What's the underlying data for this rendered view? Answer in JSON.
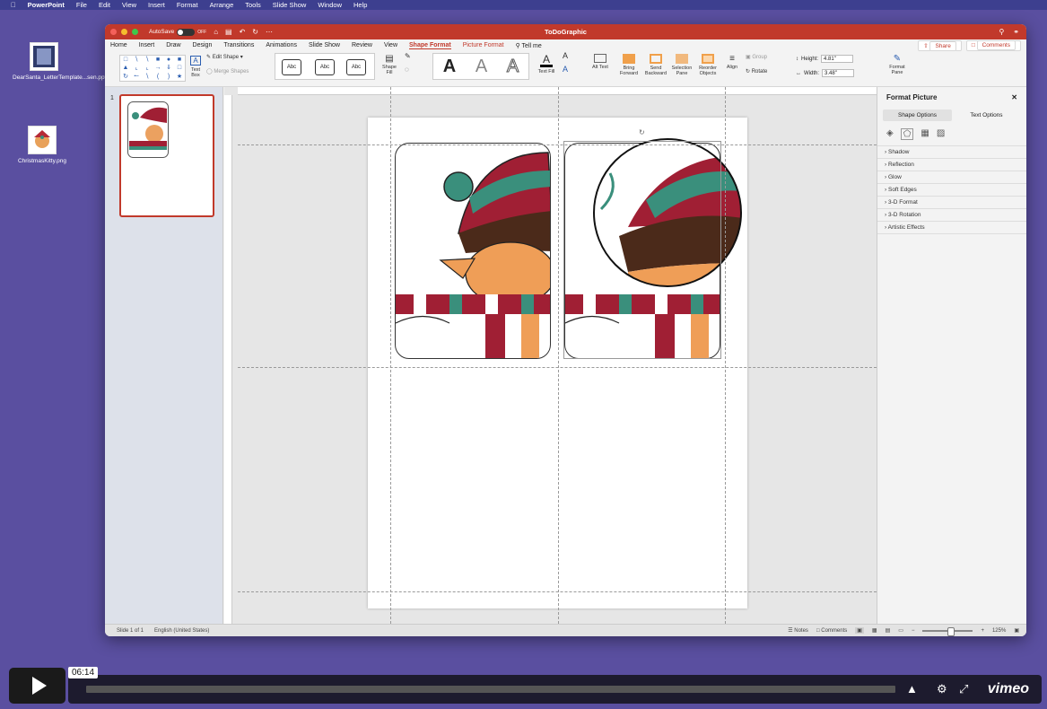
{
  "menubar": {
    "app": "PowerPoint",
    "items": [
      "File",
      "Edit",
      "View",
      "Insert",
      "Format",
      "Arrange",
      "Tools",
      "Slide Show",
      "Window",
      "Help"
    ]
  },
  "desktop": {
    "files": [
      {
        "name": "DearSanta_LetterTemplate...sen.pptx"
      },
      {
        "name": "ChristmasKitty.png"
      }
    ]
  },
  "window": {
    "title": "ToDoGraphic",
    "autosave_label": "AutoSave",
    "autosave_state": "OFF"
  },
  "ribbon_tabs": {
    "tabs": [
      "Home",
      "Insert",
      "Draw",
      "Design",
      "Transitions",
      "Animations",
      "Slide Show",
      "Review",
      "View",
      "Shape Format",
      "Picture Format"
    ],
    "active": "Shape Format",
    "tell_me": "Tell me",
    "share": "Share",
    "comments": "Comments"
  },
  "ribbon": {
    "text_box": "Text Box",
    "edit_shape": "Edit Shape",
    "merge_shapes": "Merge Shapes",
    "style_label": "Abc",
    "shape_fill": "Shape Fill",
    "wordart_letter": "A",
    "text_fill": "Text Fill",
    "alt_text": "Alt Text",
    "bring_forward": "Bring Forward",
    "send_backward": "Send Backward",
    "selection_pane": "Selection Pane",
    "reorder_objects": "Reorder Objects",
    "align": "Align",
    "group": "Group",
    "rotate": "Rotate",
    "height_label": "Height:",
    "height_value": "4.81\"",
    "width_label": "Width:",
    "width_value": "3.48\"",
    "format_pane": "Format Pane"
  },
  "thumbnails": {
    "slide_number": "1"
  },
  "format_pane": {
    "title": "Format Picture",
    "tab_shape": "Shape Options",
    "tab_text": "Text Options",
    "sections": [
      "Shadow",
      "Reflection",
      "Glow",
      "Soft Edges",
      "3-D Format",
      "3-D Rotation",
      "Artistic Effects"
    ]
  },
  "statusbar": {
    "slide": "Slide 1 of 1",
    "language": "English (United States)",
    "notes": "Notes",
    "comments": "Comments",
    "zoom": "125%"
  },
  "player": {
    "time": "06:14",
    "brand": "vimeo",
    "progress": 0.0
  },
  "colors": {
    "accent": "#c1392b",
    "desktop": "#5a4fa0"
  }
}
